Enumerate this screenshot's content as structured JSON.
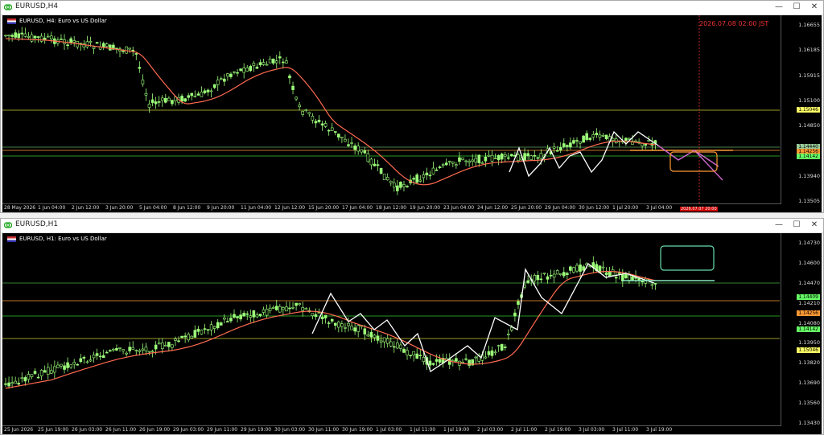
{
  "window_top": {
    "title": "EURUSD,H4",
    "chart_label": "EURUSD, H4:  Euro vs US Dollar",
    "price_ticks": [
      "1.16655",
      "1.16185",
      "1.15915",
      "1.15100",
      "1.14850",
      "1.14410",
      "1.13940",
      "1.13505"
    ],
    "level_tags": [
      {
        "text": "1.15046",
        "color": "#ffff66"
      },
      {
        "text": "1.14440",
        "color": "#99cc99"
      },
      {
        "text": "1.14256",
        "color": "#ff9933"
      },
      {
        "text": "1.14142",
        "color": "#66ff66"
      }
    ],
    "time_labels": [
      "28 May 2026",
      "1 Jun 04:00",
      "2 Jun 12:00",
      "3 Jun 20:00",
      "5 Jun 04:00",
      "8 Jun 12:00",
      "9 Jun 20:00",
      "11 Jun 04:00",
      "12 Jun 12:00",
      "15 Jun 20:00",
      "17 Jun 04:00",
      "18 Jun 12:00",
      "19 Jun 20:00",
      "23 Jun 04:00",
      "24 Jun 12:00",
      "25 Jun 20:00",
      "29 Jun 04:00",
      "30 Jun 12:00",
      "1 Jul 20:00",
      "3 Jul 04:00"
    ],
    "vertical_label": "2026.07.08 02:00 JST",
    "vertical_tag": "2026.07.07 20:00"
  },
  "window_bottom": {
    "title": "EURUSD,H1",
    "chart_label": "EURUSD, H1:  Euro vs US Dollar",
    "price_ticks": [
      "1.14730",
      "1.14600",
      "1.14470",
      "1.14210",
      "1.14080",
      "1.13950",
      "1.13820",
      "1.13690",
      "1.13560",
      "1.13430"
    ],
    "level_tags": [
      {
        "text": "1.14409",
        "color": "#66ff66"
      },
      {
        "text": "1.14256",
        "color": "#ff9933"
      },
      {
        "text": "1.14142",
        "color": "#66ff66"
      },
      {
        "text": "1.15046",
        "color": "#ffff66"
      }
    ],
    "time_labels": [
      "25 Jun 2026",
      "25 Jun 19:00",
      "26 Jun 03:00",
      "26 Jun 11:00",
      "26 Jun 19:00",
      "29 Jun 03:00",
      "29 Jun 11:00",
      "29 Jun 19:00",
      "30 Jun 03:00",
      "30 Jun 11:00",
      "30 Jun 19:00",
      "1 Jul 03:00",
      "1 Jul 11:00",
      "1 Jul 19:00",
      "2 Jul 03:00",
      "2 Jul 11:00",
      "2 Jul 19:00",
      "3 Jul 03:00",
      "3 Jul 11:00",
      "3 Jul 19:00"
    ]
  },
  "controls": {
    "minimize": "—",
    "maximize": "☐",
    "close": "✕"
  }
}
